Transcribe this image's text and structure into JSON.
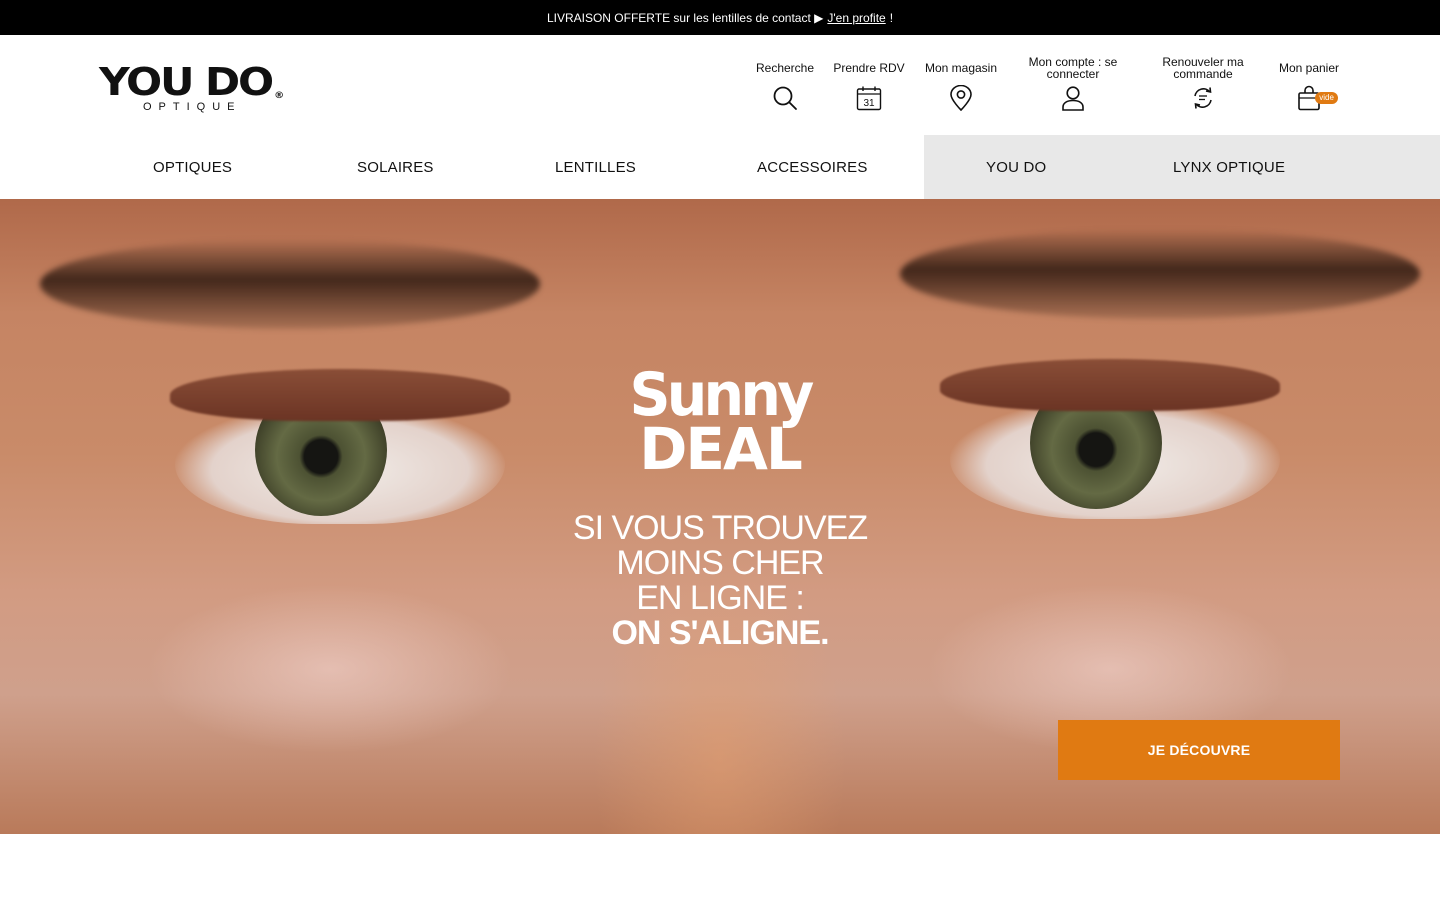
{
  "topbar": {
    "text": "LIVRAISON OFFERTE sur les lentilles de contact ▶",
    "link": "J'en profite",
    "suffix": "!"
  },
  "logo": {
    "main": "YOU DO",
    "registered": "®",
    "sub": "OPTIQUE"
  },
  "actions": [
    {
      "label": "Recherche",
      "icon": "search-icon"
    },
    {
      "label": "Prendre RDV",
      "icon": "calendar-icon",
      "icon_text": "31"
    },
    {
      "label": "Mon magasin",
      "icon": "location-pin-icon"
    },
    {
      "label": "Mon compte : se connecter",
      "icon": "user-icon"
    },
    {
      "label": "Renouveler ma commande",
      "icon": "renew-icon"
    },
    {
      "label": "Mon panier",
      "icon": "bag-icon",
      "badge": "vide"
    }
  ],
  "nav": {
    "items": [
      "OPTIQUES",
      "SOLAIRES",
      "LENTILLES",
      "ACCESSOIRES",
      "YOU DO",
      "LYNX OPTIQUE"
    ]
  },
  "hero": {
    "headline_1": "Sunny",
    "headline_2": "DEAL",
    "tagline_1": "SI VOUS TROUVEZ",
    "tagline_2": "MOINS CHER",
    "tagline_3": "EN LIGNE :",
    "tagline_4": "ON S'ALIGNE.",
    "cta": "JE DÉCOUVRE"
  },
  "colors": {
    "accent": "#e07a12",
    "topbar": "#000000",
    "nav_highlight": "#e8e8e8"
  }
}
